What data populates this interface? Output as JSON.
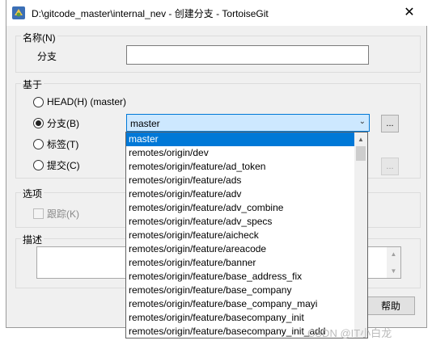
{
  "window": {
    "title": "D:\\gitcode_master\\internal_nev - 创建分支 - TortoiseGit",
    "close_symbol": "✕",
    "icon": "tortoisegit-icon"
  },
  "name_group": {
    "label": "名称(N)",
    "branch_label": "分支",
    "branch_value": ""
  },
  "base_group": {
    "label": "基于",
    "head_option": "HEAD(H) (master)",
    "branch_option": "分支(B)",
    "tag_option": "标签(T)",
    "commit_option": "提交(C)",
    "selected": "branch",
    "branch_combo_value": "master",
    "browse_label": "..."
  },
  "options_group": {
    "label": "选项",
    "track_label": "跟踪(K)",
    "track_checked": false
  },
  "description_group": {
    "label": "描述",
    "value": ""
  },
  "buttons": {
    "help": "帮助"
  },
  "dropdown": {
    "items": [
      "master",
      "remotes/origin/dev",
      "remotes/origin/feature/ad_token",
      "remotes/origin/feature/ads",
      "remotes/origin/feature/adv",
      "remotes/origin/feature/adv_combine",
      "remotes/origin/feature/adv_specs",
      "remotes/origin/feature/aicheck",
      "remotes/origin/feature/areacode",
      "remotes/origin/feature/banner",
      "remotes/origin/feature/base_address_fix",
      "remotes/origin/feature/base_company",
      "remotes/origin/feature/base_company_mayi",
      "remotes/origin/feature/basecompany_init",
      "remotes/origin/feature/basecompany_init_add"
    ],
    "selected_index": 0
  },
  "watermark": "CSDN @IT小白龙",
  "colors": {
    "accent": "#0078d7",
    "combo_bg": "#cde8ff",
    "dialog_bg": "#f0f0f0"
  }
}
